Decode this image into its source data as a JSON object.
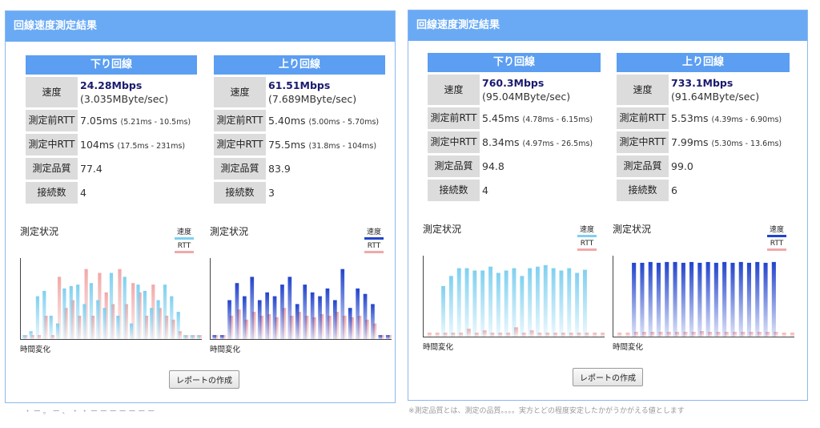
{
  "panels": [
    {
      "header": "回線速度測定結果",
      "down": {
        "title": "下り回線",
        "speed_label": "速度",
        "speed": "24.28Mbps",
        "speed_sub": "(3.035MByte/sec)",
        "rtt_before_label": "測定前RTT",
        "rtt_before": "7.05ms",
        "rtt_before_range": "(5.21ms - 10.5ms)",
        "rtt_during_label": "測定中RTT",
        "rtt_during": "104ms",
        "rtt_during_range": "(17.5ms - 231ms)",
        "quality_label": "測定品質",
        "quality": "77.4",
        "conn_label": "接続数",
        "conn": "4",
        "graph_title": "測定状況",
        "legend_speed": "速度",
        "legend_rtt": "RTT",
        "xlabel": "時間変化",
        "speed_color": "#7fd0f0",
        "rtt_color": "#f2a8a8"
      },
      "up": {
        "title": "上り回線",
        "speed_label": "速度",
        "speed": "61.51Mbps",
        "speed_sub": "(7.689MByte/sec)",
        "rtt_before_label": "測定前RTT",
        "rtt_before": "5.40ms",
        "rtt_before_range": "(5.00ms - 5.70ms)",
        "rtt_during_label": "測定中RTT",
        "rtt_during": "75.5ms",
        "rtt_during_range": "(31.8ms - 104ms)",
        "quality_label": "測定品質",
        "quality": "83.9",
        "conn_label": "接続数",
        "conn": "3",
        "graph_title": "測定状況",
        "legend_speed": "速度",
        "legend_rtt": "RTT",
        "xlabel": "時間変化",
        "speed_color": "#2244cc",
        "rtt_color": "#f2a8a8"
      },
      "report_button": "レポートの作成",
      "footer_text": "・ ー 。 ー 、 ・ ・ ー ー ー ー ー ー ー"
    },
    {
      "header": "回線速度測定結果",
      "down": {
        "title": "下り回線",
        "speed_label": "速度",
        "speed": "760.3Mbps",
        "speed_sub": "(95.04MByte/sec)",
        "rtt_before_label": "測定前RTT",
        "rtt_before": "5.45ms",
        "rtt_before_range": "(4.78ms - 6.15ms)",
        "rtt_during_label": "測定中RTT",
        "rtt_during": "8.34ms",
        "rtt_during_range": "(4.97ms - 26.5ms)",
        "quality_label": "測定品質",
        "quality": "94.8",
        "conn_label": "接続数",
        "conn": "4",
        "graph_title": "測定状況",
        "legend_speed": "速度",
        "legend_rtt": "RTT",
        "xlabel": "時間変化",
        "speed_color": "#7fd0f0",
        "rtt_color": "#f2a8a8"
      },
      "up": {
        "title": "上り回線",
        "speed_label": "速度",
        "speed": "733.1Mbps",
        "speed_sub": "(91.64MByte/sec)",
        "rtt_before_label": "測定前RTT",
        "rtt_before": "5.53ms",
        "rtt_before_range": "(4.39ms - 6.90ms)",
        "rtt_during_label": "測定中RTT",
        "rtt_during": "7.99ms",
        "rtt_during_range": "(5.30ms - 13.6ms)",
        "quality_label": "測定品質",
        "quality": "99.0",
        "conn_label": "接続数",
        "conn": "6",
        "graph_title": "測定状況",
        "legend_speed": "速度",
        "legend_rtt": "RTT",
        "xlabel": "時間変化",
        "speed_color": "#2244cc",
        "rtt_color": "#f2a8a8"
      },
      "report_button": "レポートの作成",
      "footer_text": "※測定品質とは、測定の品質。。。。実方とどの程度安定したかがうかがえる値とします"
    }
  ],
  "chart_data": [
    {
      "type": "bar",
      "series": [
        {
          "name": "速度",
          "values": [
            0.05,
            0.1,
            0.55,
            0.62,
            0.3,
            0.2,
            0.65,
            0.68,
            0.7,
            0.45,
            0.72,
            0.5,
            0.4,
            0.85,
            0.3,
            0.8,
            0.2,
            0.7,
            0.62,
            0.4,
            0.5,
            0.7,
            0.55,
            0.35,
            0.05,
            0.05,
            0.05
          ]
        },
        {
          "name": "RTT",
          "values": [
            0.05,
            0.05,
            0.05,
            0.3,
            0.05,
            0.8,
            0.4,
            0.5,
            0.3,
            0.9,
            0.3,
            0.85,
            0.6,
            0.45,
            0.9,
            0.45,
            0.72,
            0.6,
            0.3,
            0.7,
            0.4,
            0.3,
            0.25,
            0.1,
            0.05,
            0.05,
            0.05
          ]
        }
      ]
    },
    {
      "type": "bar",
      "series": [
        {
          "name": "速度",
          "values": [
            0.05,
            0.05,
            0.5,
            0.72,
            0.55,
            0.8,
            0.5,
            0.6,
            0.55,
            0.7,
            0.8,
            0.45,
            0.7,
            0.6,
            0.55,
            0.65,
            0.5,
            0.9,
            0.4,
            0.65,
            0.58,
            0.45,
            0.05,
            0.05
          ]
        },
        {
          "name": "RTT",
          "values": [
            0.05,
            0.05,
            0.3,
            0.38,
            0.25,
            0.35,
            0.3,
            0.32,
            0.28,
            0.4,
            0.3,
            0.35,
            0.3,
            0.28,
            0.32,
            0.3,
            0.35,
            0.3,
            0.28,
            0.3,
            0.25,
            0.2,
            0.05,
            0.05
          ]
        }
      ]
    },
    {
      "type": "bar",
      "series": [
        {
          "name": "速度",
          "values": [
            0.0,
            0.0,
            0.65,
            0.78,
            0.88,
            0.88,
            0.85,
            0.85,
            0.9,
            0.82,
            0.85,
            0.88,
            0.78,
            0.88,
            0.9,
            0.92,
            0.88,
            0.85,
            0.88,
            0.82,
            0.86,
            0.0,
            0.0
          ]
        },
        {
          "name": "RTT",
          "values": [
            0.05,
            0.05,
            0.05,
            0.05,
            0.05,
            0.1,
            0.05,
            0.08,
            0.05,
            0.05,
            0.05,
            0.12,
            0.05,
            0.08,
            0.05,
            0.05,
            0.05,
            0.05,
            0.05,
            0.05,
            0.05,
            0.05,
            0.05
          ]
        }
      ]
    },
    {
      "type": "bar",
      "series": [
        {
          "name": "速度",
          "values": [
            0.0,
            0.0,
            0.95,
            0.95,
            0.96,
            0.95,
            0.96,
            0.96,
            0.95,
            0.96,
            0.95,
            0.96,
            0.95,
            0.96,
            0.95,
            0.96,
            0.95,
            0.96,
            0.95,
            0.96,
            0.0,
            0.0
          ]
        },
        {
          "name": "RTT",
          "values": [
            0.05,
            0.05,
            0.06,
            0.06,
            0.06,
            0.06,
            0.06,
            0.06,
            0.06,
            0.06,
            0.07,
            0.06,
            0.06,
            0.06,
            0.06,
            0.06,
            0.06,
            0.06,
            0.06,
            0.06,
            0.05,
            0.05
          ]
        }
      ]
    }
  ]
}
